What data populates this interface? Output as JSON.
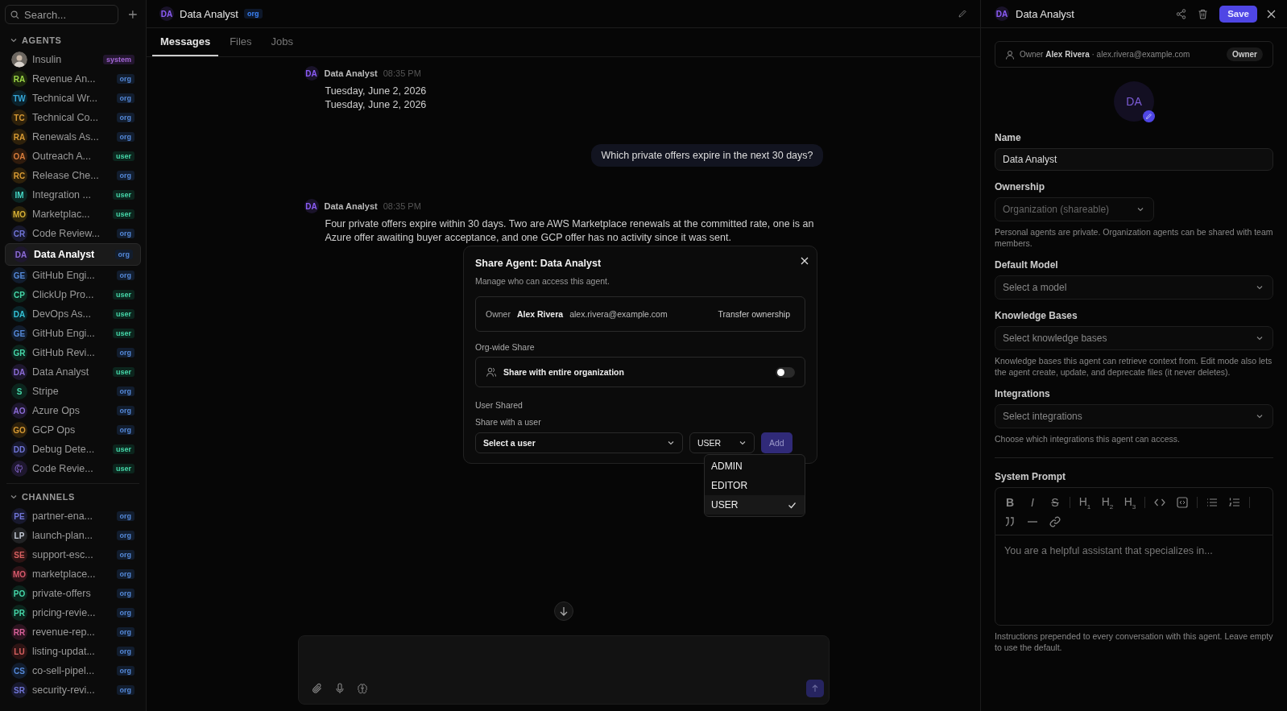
{
  "sidebar": {
    "search": {
      "placeholder": "Search..."
    },
    "sections": [
      {
        "title": "AGENTS",
        "expanded": true,
        "items": [
          {
            "kind": "photo",
            "name": "Insulin",
            "badge": {
              "text": "system",
              "color": "#23162e"
            },
            "selected": false
          },
          {
            "kind": "initials",
            "initials": "RA",
            "color": "#1d280d",
            "name": "Revenue An...",
            "badge": {
              "text": "org",
              "color": "#121d2e"
            },
            "selected": false
          },
          {
            "kind": "initials",
            "initials": "TW",
            "color": "#0b222c",
            "name": "Technical Wr...",
            "badge": {
              "text": "org",
              "color": "#121d2e"
            },
            "selected": false
          },
          {
            "kind": "initials",
            "initials": "TC",
            "color": "#2e210b",
            "name": "Technical Co...",
            "badge": {
              "text": "org",
              "color": "#121d2e"
            },
            "selected": false
          },
          {
            "kind": "initials",
            "initials": "RA",
            "color": "#2e210b",
            "name": "Renewals As...",
            "badge": {
              "text": "org",
              "color": "#121d2e"
            },
            "selected": false
          },
          {
            "kind": "initials",
            "initials": "OA",
            "color": "#2f1b0d",
            "name": "Outreach A...",
            "badge": {
              "text": "user",
              "color": "#0c251d"
            },
            "selected": false
          },
          {
            "kind": "initials",
            "initials": "RC",
            "color": "#2e210b",
            "name": "Release Che...",
            "badge": {
              "text": "org",
              "color": "#121d2e"
            },
            "selected": false
          },
          {
            "kind": "initials",
            "initials": "IM",
            "color": "#0c2522",
            "name": "Integration ...",
            "badge": {
              "text": "user",
              "color": "#0c251d"
            },
            "selected": false
          },
          {
            "kind": "initials",
            "initials": "MO",
            "color": "#2c240b",
            "name": "Marketplac...",
            "badge": {
              "text": "user",
              "color": "#0c251d"
            },
            "selected": false
          },
          {
            "kind": "initials",
            "initials": "CR",
            "color": "#18192e",
            "name": "Code Review...",
            "badge": {
              "text": "org",
              "color": "#121d2e"
            },
            "selected": false
          },
          {
            "kind": "initials",
            "initials": "DA",
            "color": "#1e172e",
            "name": "Data Analyst",
            "badge": {
              "text": "org",
              "color": "#121d2e"
            },
            "selected": true
          },
          {
            "kind": "initials",
            "initials": "GE",
            "color": "#121d2e",
            "name": "GitHub Engi...",
            "badge": {
              "text": "org",
              "color": "#121d2e"
            },
            "selected": false
          },
          {
            "kind": "initials",
            "initials": "CP",
            "color": "#0c251d",
            "name": "ClickUp Pro...",
            "badge": {
              "text": "user",
              "color": "#0c251d"
            },
            "selected": false
          },
          {
            "kind": "initials",
            "initials": "DA",
            "color": "#0a2529",
            "name": "DevOps As...",
            "badge": {
              "text": "user",
              "color": "#0c251d"
            },
            "selected": false
          },
          {
            "kind": "initials",
            "initials": "GE",
            "color": "#121d2e",
            "name": "GitHub Engi...",
            "badge": {
              "text": "user",
              "color": "#0c251d"
            },
            "selected": false
          },
          {
            "kind": "initials",
            "initials": "GR",
            "color": "#0c251d",
            "name": "GitHub Revi...",
            "badge": {
              "text": "org",
              "color": "#121d2e"
            },
            "selected": false
          },
          {
            "kind": "initials",
            "initials": "DA",
            "color": "#1e172e",
            "name": "Data Analyst",
            "badge": {
              "text": "user",
              "color": "#0c251d"
            },
            "selected": false
          },
          {
            "kind": "initials",
            "initials": "S",
            "color": "#0c251d",
            "name": "Stripe",
            "badge": {
              "text": "org",
              "color": "#121d2e"
            },
            "selected": false
          },
          {
            "kind": "initials",
            "initials": "AO",
            "color": "#1e172e",
            "name": "Azure Ops",
            "badge": {
              "text": "org",
              "color": "#121d2e"
            },
            "selected": false
          },
          {
            "kind": "initials",
            "initials": "GO",
            "color": "#2e210b",
            "name": "GCP Ops",
            "badge": {
              "text": "org",
              "color": "#121d2e"
            },
            "selected": false
          },
          {
            "kind": "initials",
            "initials": "DD",
            "color": "#18192e",
            "name": "Debug Dete...",
            "badge": {
              "text": "user",
              "color": "#0c251d"
            },
            "selected": false
          },
          {
            "kind": "icon",
            "color": "#1e172e",
            "name": "Code Revie...",
            "badge": {
              "text": "user",
              "color": "#0c251d"
            },
            "selected": false
          }
        ]
      },
      {
        "title": "CHANNELS",
        "expanded": true,
        "items": [
          {
            "kind": "initials",
            "initials": "PE",
            "color": "#18192e",
            "name": "partner-ena...",
            "badge": {
              "text": "org",
              "color": "#121d2e"
            },
            "selected": false
          },
          {
            "kind": "initials",
            "initials": "LP",
            "color": "#212224",
            "name": "launch-plan...",
            "badge": {
              "text": "org",
              "color": "#121d2e"
            },
            "selected": false
          },
          {
            "kind": "initials",
            "initials": "SE",
            "color": "#2d1414",
            "name": "support-esc...",
            "badge": {
              "text": "org",
              "color": "#121d2e"
            },
            "selected": false
          },
          {
            "kind": "initials",
            "initials": "MO",
            "color": "#2e1317",
            "name": "marketplace...",
            "badge": {
              "text": "org",
              "color": "#121d2e"
            },
            "selected": false
          },
          {
            "kind": "initials",
            "initials": "PO",
            "color": "#0c251d",
            "name": "private-offers",
            "badge": {
              "text": "org",
              "color": "#121d2e"
            },
            "selected": false
          },
          {
            "kind": "initials",
            "initials": "PR",
            "color": "#0c251d",
            "name": "pricing-revie...",
            "badge": {
              "text": "org",
              "color": "#121d2e"
            },
            "selected": false
          },
          {
            "kind": "initials",
            "initials": "RR",
            "color": "#2d1420",
            "name": "revenue-rep...",
            "badge": {
              "text": "org",
              "color": "#121d2e"
            },
            "selected": false
          },
          {
            "kind": "initials",
            "initials": "LU",
            "color": "#2d1414",
            "name": "listing-updat...",
            "badge": {
              "text": "org",
              "color": "#121d2e"
            },
            "selected": false
          },
          {
            "kind": "initials",
            "initials": "CS",
            "color": "#121d2e",
            "name": "co-sell-pipel...",
            "badge": {
              "text": "org",
              "color": "#121d2e"
            },
            "selected": false
          },
          {
            "kind": "initials",
            "initials": "SR",
            "color": "#18192e",
            "name": "security-revi...",
            "badge": {
              "text": "org",
              "color": "#121d2e"
            },
            "selected": false
          }
        ]
      }
    ]
  },
  "header": {
    "initials": "DA",
    "title": "Data Analyst",
    "badge": "org"
  },
  "tabs": [
    {
      "label": "Messages",
      "selected": true
    },
    {
      "label": "Files",
      "selected": false
    },
    {
      "label": "Jobs",
      "selected": false
    }
  ],
  "messages": [
    {
      "kind": "agent",
      "initials": "DA",
      "author": "Data Analyst",
      "time": "08:35 PM",
      "lines": [
        "Tuesday, June 2, 2026",
        "Tuesday, June 2, 2026"
      ]
    },
    {
      "kind": "user",
      "text": "Which private offers expire in the next 30 days?"
    },
    {
      "kind": "agent",
      "initials": "DA",
      "author": "Data Analyst",
      "time": "08:35 PM",
      "lines": [
        "Four private offers expire within 30 days. Two are AWS Marketplace renewals at the committed rate, one is an Azure offer awaiting buyer acceptance, and one GCP offer has no activity since it was sent."
      ]
    }
  ],
  "share_dialog": {
    "title": "Share Agent: Data Analyst",
    "subtitle": "Manage who can access this agent.",
    "owner_label": "Owner",
    "owner_name": "Alex Rivera",
    "owner_email": "alex.rivera@example.com",
    "transfer": "Transfer ownership",
    "org_label": "Org-wide Share",
    "org_toggle_label": "Share with entire organization",
    "org_on": false,
    "user_label": "User Shared",
    "user_hint": "Share with a user",
    "user_placeholder": "Select a user",
    "role": "USER",
    "add": "Add",
    "add_disabled": true,
    "role_menu_open": true,
    "role_menu": [
      {
        "label": "ADMIN",
        "selected": false
      },
      {
        "label": "EDITOR",
        "selected": false
      },
      {
        "label": "USER",
        "selected": true
      }
    ]
  },
  "agent_panel": {
    "initials": "DA",
    "title": "Data Analyst",
    "save": "Save",
    "owner": {
      "text": "Owner **Alex Rivera** · alex.rivera@example.com",
      "badge": "Owner"
    },
    "avatar_initials": "DA",
    "fields": [
      {
        "kind": "input",
        "label": "Name",
        "value": "Data Analyst",
        "disabled": false
      },
      {
        "kind": "select",
        "label": "Ownership",
        "value": "Organization (shareable)",
        "disabled": true,
        "help": "Personal agents are private. Organization agents can be shared with team members."
      },
      {
        "kind": "select",
        "label": "Default Model",
        "placeholder": "Select a model",
        "disabled": false
      },
      {
        "kind": "select",
        "label": "Knowledge Bases",
        "placeholder": "Select knowledge bases",
        "disabled": false,
        "help": "Knowledge bases this agent can retrieve context from. Edit mode also lets the agent create, update, and deprecate files (it never deletes)."
      },
      {
        "kind": "select",
        "label": "Integrations",
        "placeholder": "Select integrations",
        "disabled": false,
        "help": "Choose which integrations this agent can access."
      }
    ],
    "system_prompt": {
      "label": "System Prompt",
      "placeholder": "You are a helpful assistant that specializes in...",
      "help": "Instructions prepended to every conversation with this agent. Leave empty to use the default.",
      "toolbar": [
        {
          "kind": "bold",
          "label": "B"
        },
        {
          "kind": "italic",
          "label": "I"
        },
        {
          "kind": "strike",
          "label": "S"
        },
        {
          "kind": "separator"
        },
        {
          "kind": "heading",
          "label": "H$_{1}$"
        },
        {
          "kind": "heading",
          "label": "H$_{2}$"
        },
        {
          "kind": "heading",
          "label": "H$_{3}$"
        },
        {
          "kind": "separator"
        },
        {
          "kind": "code"
        },
        {
          "kind": "code-block"
        },
        {
          "kind": "separator"
        },
        {
          "kind": "bullet-list"
        },
        {
          "kind": "ordered-list"
        },
        {
          "kind": "separator"
        },
        {
          "kind": "quote"
        },
        {
          "kind": "rule"
        },
        {
          "kind": "link"
        }
      ]
    }
  }
}
